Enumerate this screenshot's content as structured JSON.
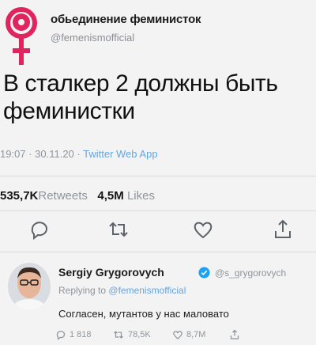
{
  "account": {
    "name": "обьединение феминисток",
    "handle": "@femenismofficial"
  },
  "tweet": {
    "text_line1": "В сталкер 2 должны быть",
    "text_line2": "феминистки",
    "time": "19:07",
    "date": "30.11.20",
    "separator": "·",
    "source": "Twitter Web App"
  },
  "stats": {
    "retweets_count": "535,7K",
    "retweets_label": "Retweets",
    "likes_count": "4,5M",
    "likes_label": "Likes"
  },
  "actions": {
    "icons": [
      "reply-icon",
      "retweet-icon",
      "like-icon",
      "share-icon"
    ]
  },
  "reply": {
    "name": "Sergiy Grygorovych",
    "handle": "@s_grygorovych",
    "replying_prefix": "Replying to",
    "replying_to": "@femenismofficial",
    "text": "Согласен, мутантов у нас маловато",
    "reply_count": "1 818",
    "retweet_count": "78,5K",
    "like_count": "8,7M"
  },
  "colors": {
    "logo": "#e0245e",
    "link": "#64a6e3",
    "muted": "#8f959c",
    "verified": "#1da1f2"
  }
}
